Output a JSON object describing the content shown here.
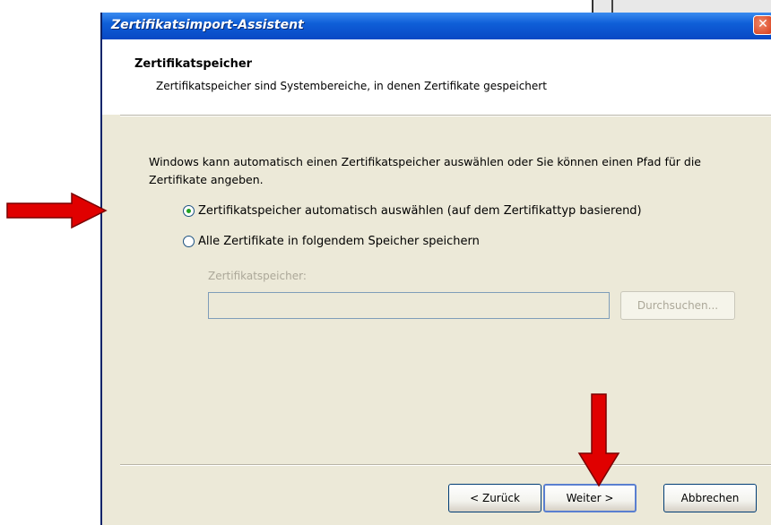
{
  "dialog": {
    "title": "Zertifikatsimport-Assistent",
    "close_glyph": "✕"
  },
  "header": {
    "title": "Zertifikatspeicher",
    "subtitle": "Zertifikatspeicher sind Systembereiche, in denen Zertifikate gespeichert"
  },
  "description": "Windows kann automatisch einen Zertifikatspeicher auswählen oder Sie können einen Pfad für die Zertifikate angeben.",
  "options": {
    "auto_label": "Zertifikatspeicher automatisch auswählen (auf dem Zertifikattyp basierend)",
    "auto_selected": true,
    "manual_label": "Alle Zertifikate in folgendem Speicher speichern",
    "manual_selected": false
  },
  "store": {
    "label": "Zertifikatspeicher:",
    "value": "",
    "browse_label": "Durchsuchen..."
  },
  "footer": {
    "back_label": "< Zurück",
    "next_label": "Weiter >",
    "cancel_label": "Abbrechen"
  },
  "colors": {
    "titlebar": "#0f5fd8",
    "annotation_arrow": "#e00000",
    "radio_dot": "#21a121"
  }
}
